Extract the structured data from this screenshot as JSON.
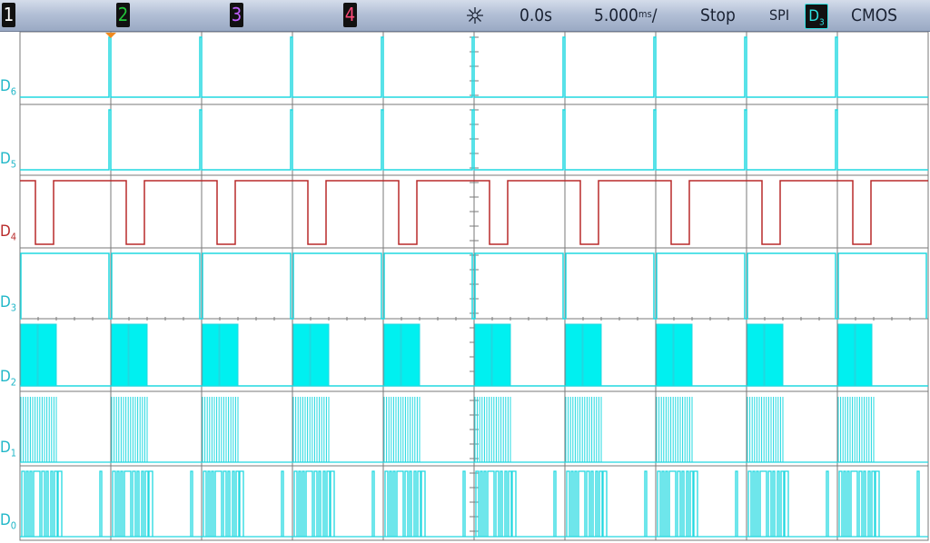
{
  "topbar": {
    "ch1": "1",
    "ch2": "2",
    "ch3": "3",
    "ch4": "4",
    "acq_icon": "acquisition-sparkle-icon",
    "time_pos": "0.0s",
    "time_div": "5.000",
    "time_div_unit": "ms",
    "time_div_suffix": "/",
    "run_state": "Stop",
    "protocol": "SPI",
    "trigger_src": "D",
    "trigger_src_sub": "3",
    "logic_level": "CMOS"
  },
  "channels": [
    {
      "label": "D",
      "sub": "6"
    },
    {
      "label": "D",
      "sub": "5"
    },
    {
      "label": "D",
      "sub": "4"
    },
    {
      "label": "D",
      "sub": "3"
    },
    {
      "label": "D",
      "sub": "2"
    },
    {
      "label": "D",
      "sub": "1"
    },
    {
      "label": "D",
      "sub": "0"
    }
  ],
  "colors": {
    "trace": "#20d8e0",
    "trace_d4": "#b82a2a",
    "fill_d2": "#00f0f0",
    "grid": "#7a7a7a",
    "trigger_marker": "#f08a1e"
  }
}
